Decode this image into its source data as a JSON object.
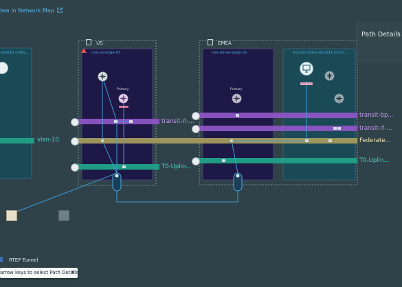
{
  "header": {
    "link_text": "iew in Network Map"
  },
  "locations": {
    "us": "US",
    "emea": "EMEA"
  },
  "nodes": {
    "left_edge": "ess010.cmbu...",
    "us_edge": "nsx-us-edge-03",
    "emea_edge": "nsx-emea-edge-01",
    "emea_vm": "w1-vmi-trans-esx031.vmi.c..."
  },
  "labels": {
    "primary_us": "Primary",
    "primary_emea": "Primary"
  },
  "segments": {
    "vlan": "vlan-10",
    "us_transit": "transit-rl-...",
    "us_uplink": "T0-Uplin...",
    "emea_transit_bp": "transit-bp...",
    "emea_transit_rl": "transit-rl-...",
    "federated": "Federate...",
    "emea_uplink": "T0-Uplin..."
  },
  "panel": {
    "title": "Path Details"
  },
  "legend": {
    "rtep": "RTEP Tunnel"
  },
  "toast": {
    "text": "arrow keys to select Path Details",
    "close": "✕"
  },
  "colors": {
    "background": "#2f4249",
    "teal": "#1f9c83",
    "purple": "#8d55c4",
    "yellow": "#a39a5f",
    "tunnel": "#3f9ed8",
    "alert": "#e05050"
  },
  "icons": {
    "external": "external-link-icon",
    "location": "building-icon",
    "router": "router-icon",
    "segment": "segment-icon",
    "vm": "monitor-icon",
    "host": "host-icon"
  }
}
